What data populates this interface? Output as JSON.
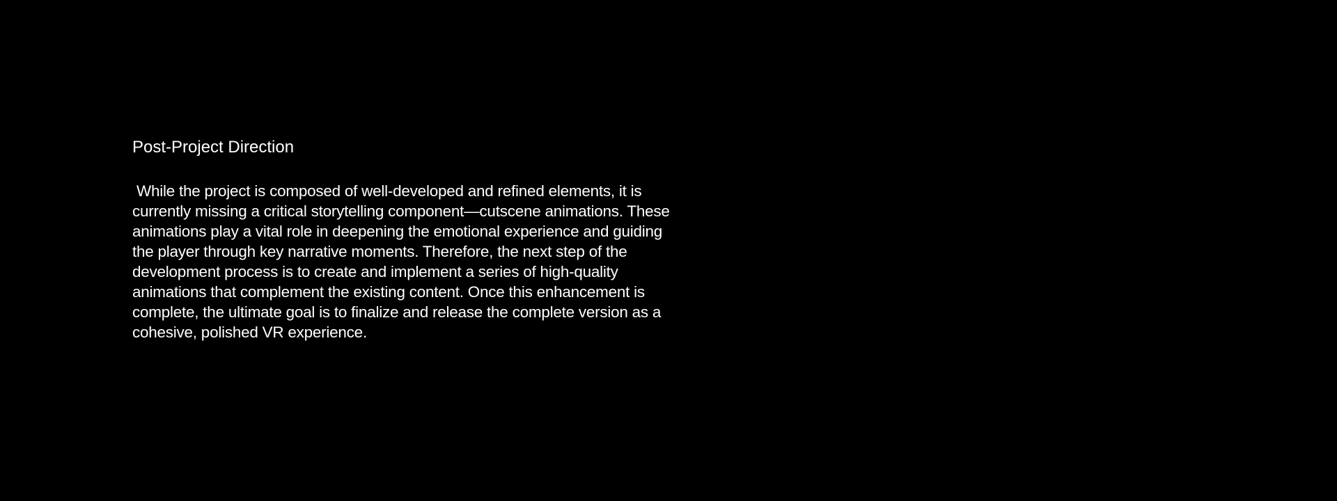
{
  "section": {
    "title": "Post-Project Direction",
    "body": " While the project is composed of well-developed and refined elements, it is\ncurrently missing a critical storytelling component—cutscene animations. These\nanimations play a vital role in deepening the emotional experience and guiding\nthe player through key narrative moments. Therefore, the next step of the\ndevelopment process is to create and implement a series of high-quality\nanimations that complement the existing content. Once this enhancement is\ncomplete, the ultimate goal is to finalize and release the complete version as a\ncohesive, polished VR experience."
  },
  "colors": {
    "background": "#000000",
    "text": "#ffffff"
  }
}
